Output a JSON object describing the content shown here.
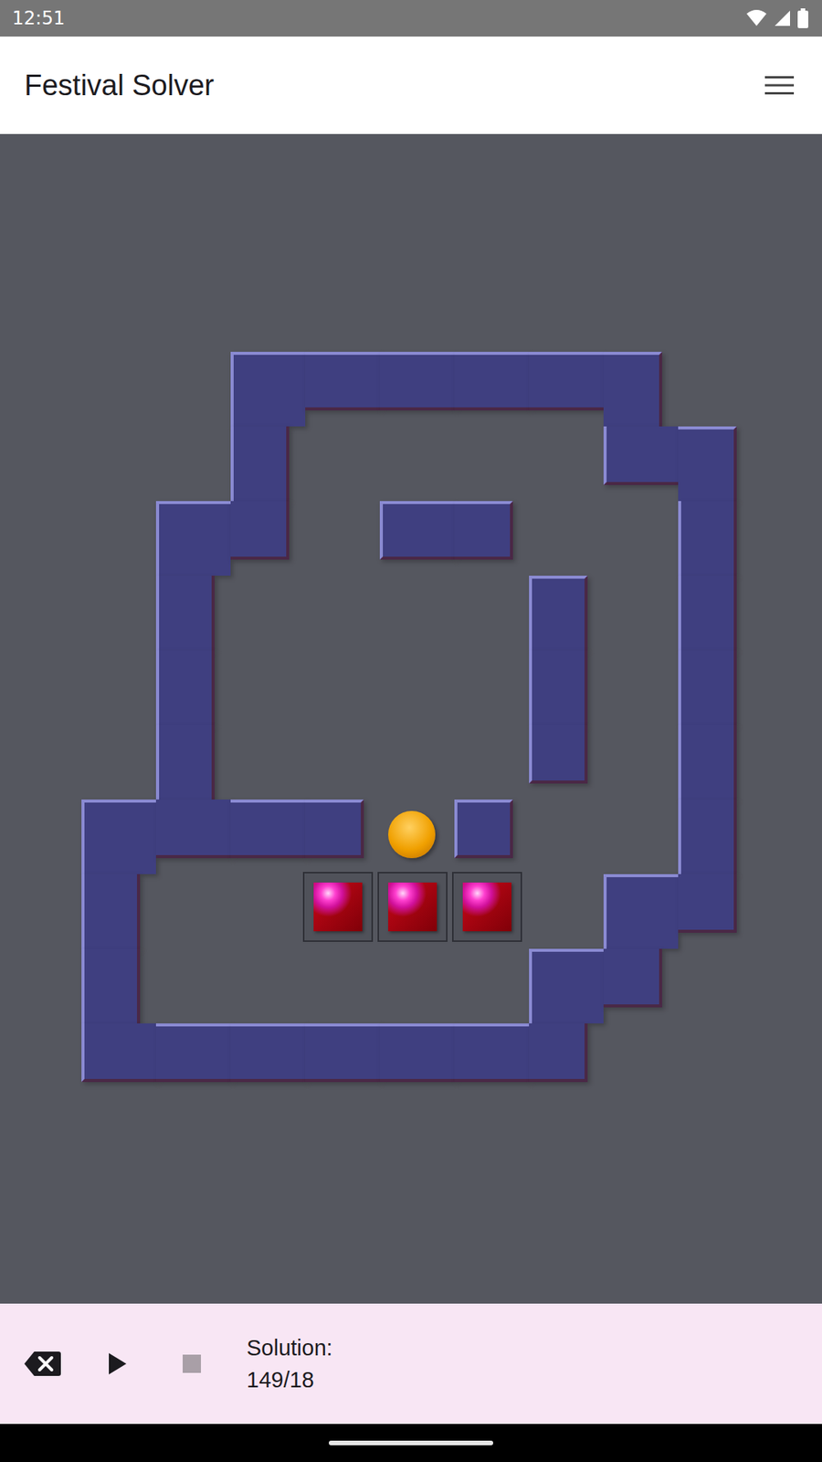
{
  "status_bar": {
    "time": "12:51"
  },
  "app_bar": {
    "title": "Festival Solver"
  },
  "board": {
    "rows": [
      "   ###### ",
      "   #    ##",
      "  ## ##  #",
      "  #    # #",
      "  #    # #",
      "  #    # #",
      " ####@#  #",
      " #  *** ##",
      " #     ## ",
      " #######  "
    ]
  },
  "bottom_bar": {
    "label": "Solution:",
    "value": "149/18"
  }
}
